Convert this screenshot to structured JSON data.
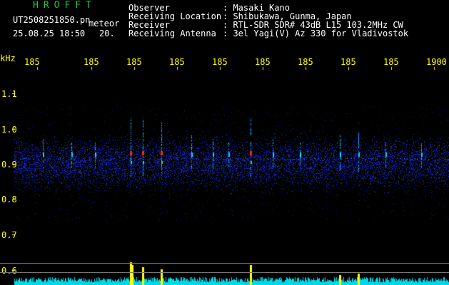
{
  "header": {
    "brand": "HROFFT",
    "filename": "UT2508251850.pn",
    "mode": "meteor",
    "datetime": "25.08.25 18:50",
    "minute_mark": "20.",
    "info": [
      {
        "label": "Observer",
        "value": ": Masaki Kano"
      },
      {
        "label": "Receiving Location",
        "value": ": Shibukawa, Gunma, Japan"
      },
      {
        "label": "Receiver",
        "value": ": RTL-SDR SDR# 43dB L15 103.2MHz CW"
      },
      {
        "label": "Receiving Antenna",
        "value": ": 3el Yagi(V) Az 330 for Vladivostok"
      }
    ]
  },
  "time_axis": {
    "ticks": [
      "185",
      "185",
      "185",
      "185",
      "185",
      "185",
      "185",
      "185",
      "185",
      "1900"
    ]
  },
  "freq_axis": {
    "unit": "kHz",
    "ticks": [
      "1.1",
      "1.0",
      "0.9",
      "0.8",
      "0.7",
      "0.6"
    ]
  },
  "colors": {
    "background": "#000000",
    "axis_text": "#ffff00",
    "header_text": "#ffffff",
    "brand": "#22c33a",
    "noise": "#1a2cc8",
    "trace_cyan": "#00e0ff",
    "echo_red": "#ff2020",
    "level_peak": "#ffff00"
  }
}
